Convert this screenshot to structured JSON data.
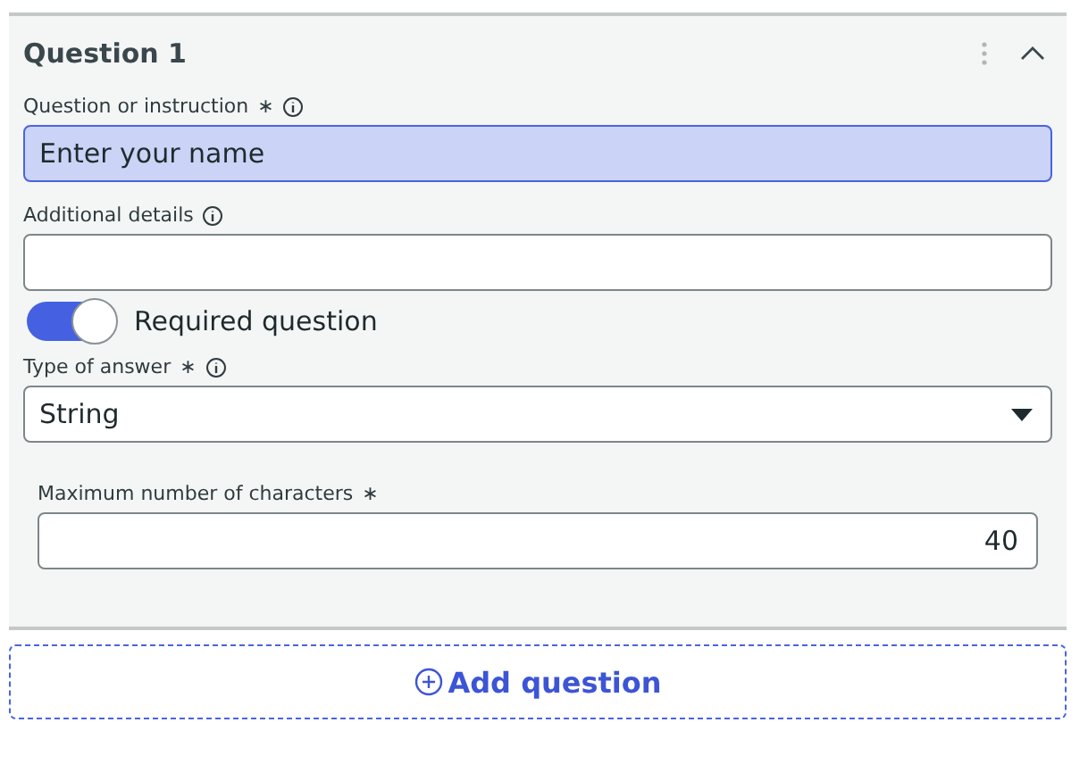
{
  "question": {
    "title": "Question 1",
    "expanded": true,
    "fields": [
      {
        "kind": "text",
        "label": "Question or instruction",
        "required_mark": "∗",
        "info": true,
        "value": "Enter your name",
        "focused": true
      },
      {
        "kind": "text",
        "label": "Additional details",
        "info": true,
        "focused": false
      },
      {
        "kind": "toggle",
        "label": "Required question",
        "on": true
      },
      {
        "kind": "select",
        "label": "Type of answer",
        "required_mark": "∗",
        "info": true,
        "value": "String"
      }
    ],
    "sub_fields": [
      {
        "kind": "number",
        "label": "Maximum number of characters",
        "required_mark": "∗",
        "value": "40"
      }
    ]
  },
  "add_button": {
    "label": "Add question"
  }
}
